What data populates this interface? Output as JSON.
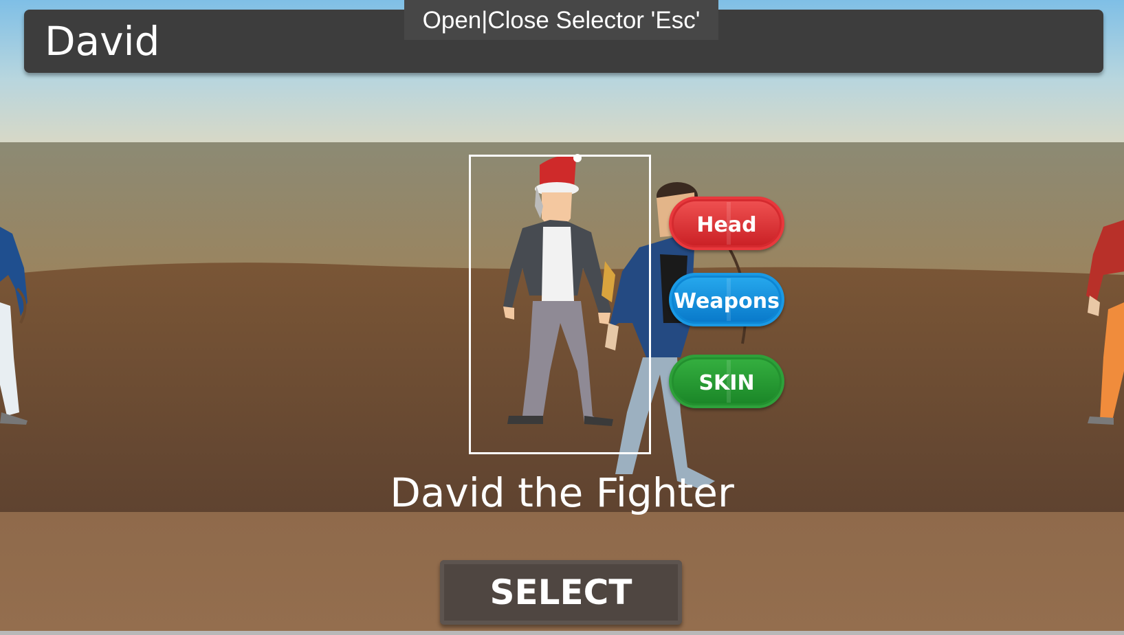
{
  "header": {
    "player_name": "David",
    "hint": "Open|Close Selector 'Esc'"
  },
  "character": {
    "title": "David the Fighter"
  },
  "buttons": {
    "head": "Head",
    "weapons": "Weapons",
    "skin": "SKIN",
    "select": "SELECT"
  },
  "colors": {
    "head": "#d52a2f",
    "weapons": "#0d86d4",
    "skin": "#23902f",
    "top_bar": "#3d3d3d"
  }
}
